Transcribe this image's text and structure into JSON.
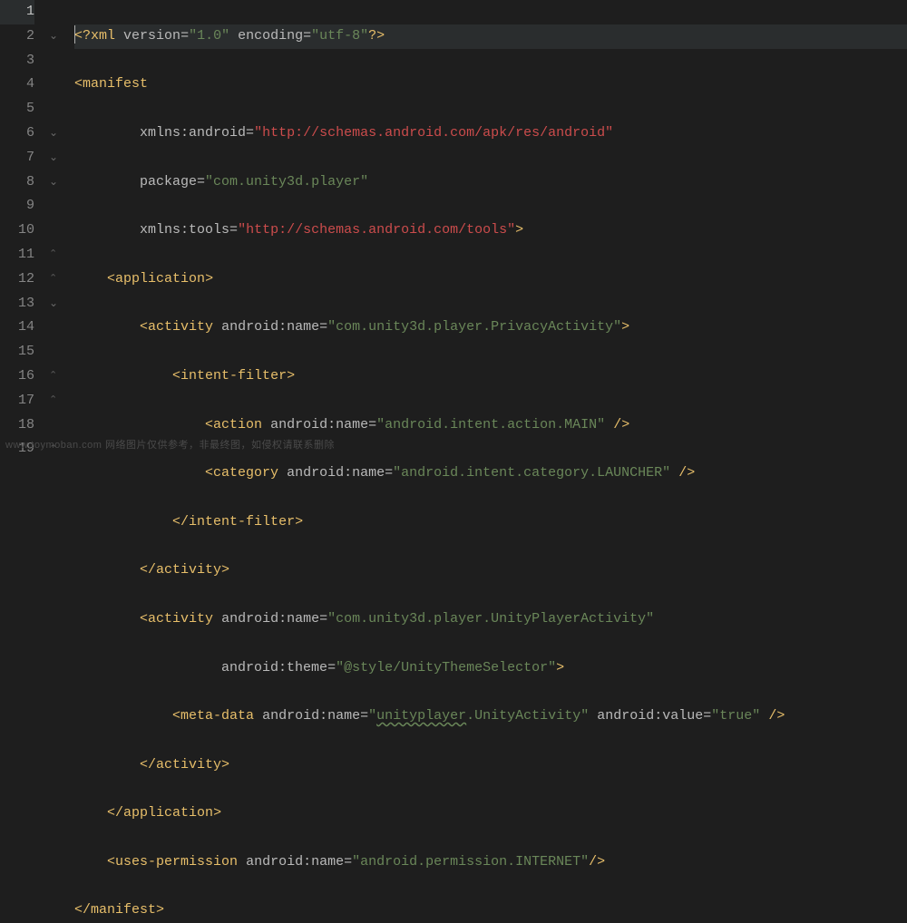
{
  "editor": {
    "line_count": 19,
    "active_line": 1,
    "lines": {
      "l1": {
        "n": "1"
      },
      "l2": {
        "n": "2"
      },
      "l3": {
        "n": "3"
      },
      "l4": {
        "n": "4"
      },
      "l5": {
        "n": "5"
      },
      "l6": {
        "n": "6"
      },
      "l7": {
        "n": "7"
      },
      "l8": {
        "n": "8"
      },
      "l9": {
        "n": "9"
      },
      "l10": {
        "n": "10"
      },
      "l11": {
        "n": "11"
      },
      "l12": {
        "n": "12"
      },
      "l13": {
        "n": "13"
      },
      "l14": {
        "n": "14"
      },
      "l15": {
        "n": "15"
      },
      "l16": {
        "n": "16"
      },
      "l17": {
        "n": "17"
      },
      "l18": {
        "n": "18"
      },
      "l19": {
        "n": "19"
      }
    }
  },
  "tok": {
    "xml_open": "<?",
    "xml_kw": "xml",
    "version_attr": "version",
    "version_val": "\"1.0\"",
    "encoding_attr": "encoding",
    "encoding_val": "\"utf-8\"",
    "xml_close": "?>",
    "lt": "<",
    "ltc": "</",
    "gt": ">",
    "sc": "/>",
    "eq": "=",
    "manifest": "manifest",
    "xmlns_android": "xmlns:android",
    "android_ns_url": "\"http://schemas.android.com/apk/res/android\"",
    "package_attr": "package",
    "package_val": "\"com.unity3d.player\"",
    "xmlns_tools": "xmlns:tools",
    "tools_ns_url": "\"http://schemas.android.com/tools\"",
    "application": "application",
    "activity": "activity",
    "android_name": "android:name",
    "privacy_activity": "\"com.unity3d.player.PrivacyActivity\"",
    "intent_filter": "intent-filter",
    "action": "action",
    "action_main": "\"android.intent.action.MAIN\"",
    "category": "category",
    "category_launcher": "\"android.intent.category.LAUNCHER\"",
    "unity_player_activity": "\"com.unity3d.player.UnityPlayerActivity\"",
    "android_theme": "android:theme",
    "theme_val": "\"@style/UnityThemeSelector\"",
    "meta_data": "meta-data",
    "meta_name_val": "\"",
    "meta_name_text1": "unityplayer",
    "meta_name_text2": ".UnityActivity",
    "meta_name_close": "\"",
    "android_value": "android:value",
    "true_val": "\"true\"",
    "uses_permission": "uses-permission",
    "internet_perm": "\"android.permission.INTERNET\""
  },
  "watermark": "www.toymoban.com  网络图片仅供参考，非最终图，如侵权请联系删除"
}
